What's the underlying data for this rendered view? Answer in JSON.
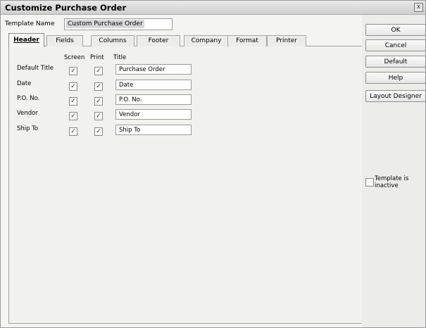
{
  "window": {
    "title": "Customize Purchase Order",
    "close_glyph": "x"
  },
  "template_name": {
    "label": "Template Name",
    "value": "Custom Purchase Order"
  },
  "tabs": [
    {
      "label": "Header",
      "active": true
    },
    {
      "label": "Fields"
    },
    {
      "label": "Columns"
    },
    {
      "label": "Footer"
    },
    {
      "label": "Company"
    },
    {
      "label": "Format"
    },
    {
      "label": "Printer"
    }
  ],
  "columns": {
    "screen": "Screen",
    "print": "Print",
    "title": "Title"
  },
  "rows": [
    {
      "label": "Default Title",
      "screen": true,
      "print": true,
      "title": "Purchase Order"
    },
    {
      "label": "Date",
      "screen": true,
      "print": true,
      "title": "Date"
    },
    {
      "label": "P.O. No.",
      "screen": true,
      "print": true,
      "title": "P.O. No."
    },
    {
      "label": "Vendor",
      "screen": true,
      "print": true,
      "title": "Vendor"
    },
    {
      "label": "Ship To",
      "screen": true,
      "print": true,
      "title": "Ship To"
    }
  ],
  "buttons": {
    "ok": "OK",
    "cancel": "Cancel",
    "default": "Default",
    "help": "Help",
    "layout_designer": "Layout Designer"
  },
  "inactive": {
    "label_line1": "Template is",
    "label_line2": "inactive",
    "checked": false
  },
  "check_glyph": "✓"
}
